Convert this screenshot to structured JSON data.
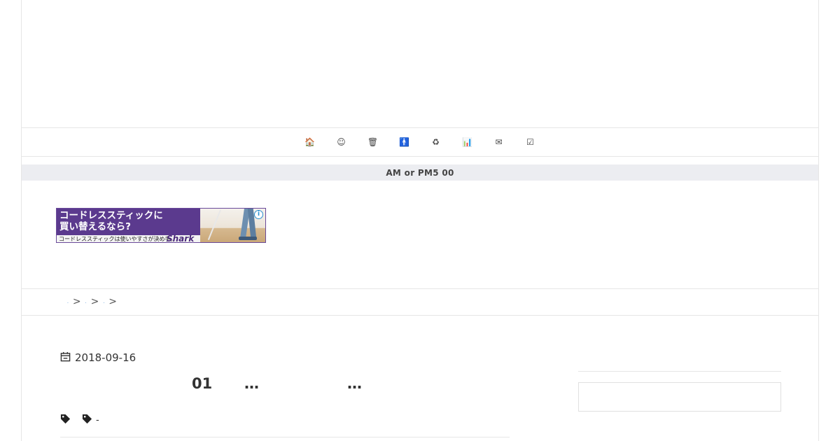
{
  "nav": {
    "icons": [
      {
        "name": "home-icon",
        "glyph": "🏠"
      },
      {
        "name": "smile-icon",
        "glyph": "☺"
      },
      {
        "name": "trash-icon",
        "glyph": "🗑"
      },
      {
        "name": "person-icon",
        "glyph": "🚹"
      },
      {
        "name": "recycle-icon",
        "glyph": "♻"
      },
      {
        "name": "bar-chart-icon",
        "glyph": "📊"
      },
      {
        "name": "envelope-icon",
        "glyph": "✉"
      },
      {
        "name": "checkbox-icon",
        "glyph": "☑"
      }
    ]
  },
  "notice": {
    "text": "AM or PM5  00"
  },
  "ad": {
    "headline_line1": "コードレススティックに",
    "headline_line2": "買い替えるなら?",
    "tagline": "コードレススティックは使いやすさが決め手。",
    "brand": "Shark",
    "info": "i"
  },
  "breadcrumb": {
    "links": [
      ".",
      ".",
      "."
    ],
    "separator": ">"
  },
  "post": {
    "date": "2018-09-16",
    "title_parts": [
      "01",
      "…",
      "…"
    ],
    "tags": [
      "",
      "-"
    ]
  },
  "colors": {
    "notice_bg": "#ecedf1",
    "ad_purple": "#5b3a8e",
    "link_blue": "#1a73c9"
  }
}
